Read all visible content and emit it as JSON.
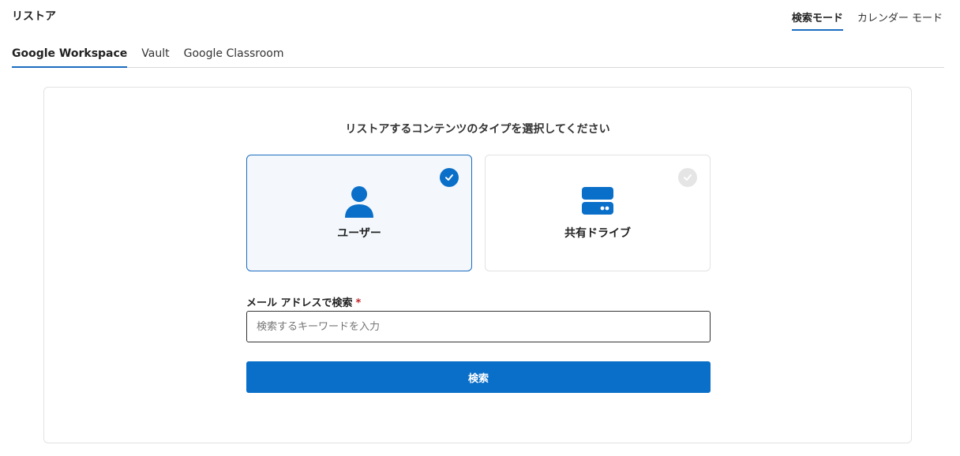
{
  "page": {
    "title": "リストア"
  },
  "mode_tabs": [
    {
      "label": "検索モード",
      "active": true
    },
    {
      "label": "カレンダー モード",
      "active": false
    }
  ],
  "product_tabs": [
    {
      "label": "Google Workspace",
      "active": true
    },
    {
      "label": "Vault",
      "active": false
    },
    {
      "label": "Google Classroom",
      "active": false
    }
  ],
  "restore": {
    "heading": "リストアするコンテンツのタイプを選択してください",
    "options": [
      {
        "label": "ユーザー",
        "icon": "user-icon",
        "selected": true
      },
      {
        "label": "共有ドライブ",
        "icon": "shared-drive-icon",
        "selected": false
      }
    ],
    "field_label": "メール アドレスで検索",
    "required_mark": "*",
    "search_placeholder": "検索するキーワードを入力",
    "search_value": "",
    "search_button_label": "検索"
  },
  "colors": {
    "accent": "#0a6fc9",
    "selected_bg": "#f4f8fc",
    "required": "#c0262d"
  }
}
